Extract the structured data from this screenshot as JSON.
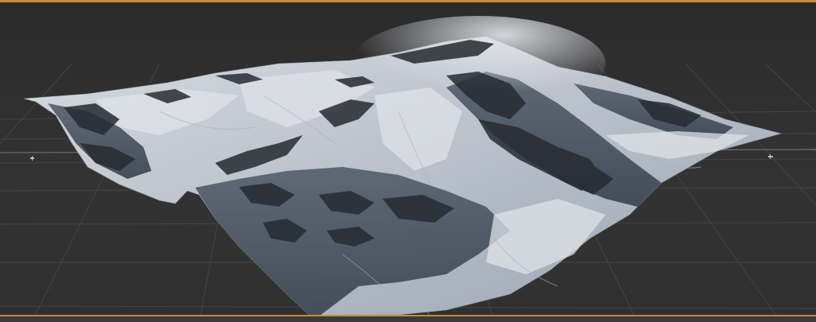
{
  "viewport": {
    "background_color": "#2e2e2e",
    "grid_color": "#444444",
    "frame_accent_color": "#c98a3a",
    "terrain_snow_color": "#c7ccd4",
    "terrain_shadow_color": "#3f4a57",
    "terrain_rock_color": "#252a30"
  },
  "icons": {
    "left_axis_marker": "axis-marker-icon",
    "right_axis_marker": "axis-marker-icon"
  }
}
